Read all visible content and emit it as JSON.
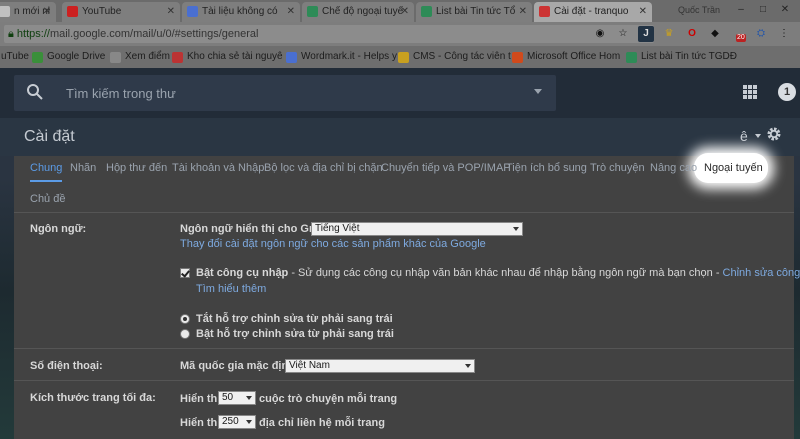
{
  "browser": {
    "tabs": [
      {
        "title": "n mới nh",
        "icon_color": "#c0c0c0"
      },
      {
        "title": "YouTube",
        "icon_color": "#cc2020"
      },
      {
        "title": "Tài liệu không có",
        "icon_color": "#4a6fd0"
      },
      {
        "title": "Chế độ ngoại tuyế",
        "icon_color": "#2e8b57"
      },
      {
        "title": "List bài Tin tức Tổ",
        "icon_color": "#2e8b57"
      },
      {
        "title": "Cài đặt - tranquo",
        "icon_color": "#c33",
        "active": true
      }
    ],
    "profile_name": "Quốc Trần",
    "url_scheme": "https://",
    "url_rest": "mail.google.com/mail/u/0/#settings/general",
    "bookmarks": [
      {
        "label": "uTube",
        "icon_color": "#cc2020"
      },
      {
        "label": "Google Drive",
        "icon_color": "#3a8f3a"
      },
      {
        "label": "Xem điểm",
        "icon_color": "#888"
      },
      {
        "label": "Kho chia sẻ tài nguyê",
        "icon_color": "#b33"
      },
      {
        "label": "Wordmark.it - Helps y",
        "icon_color": "#4a6fd0"
      },
      {
        "label": "CMS - Công tác viên t",
        "icon_color": "#c8a020"
      },
      {
        "label": "Microsoft Office Hom",
        "icon_color": "#d04a1c"
      },
      {
        "label": "List bài Tin tức TGDĐ",
        "icon_color": "#2e8b57"
      }
    ],
    "extension_badge": "20"
  },
  "gmail": {
    "search_placeholder": "Tìm kiếm trong thư",
    "notification_count": "1",
    "settings_title": "Cài đặt",
    "lang_glyph": "ê"
  },
  "settings": {
    "tabs": [
      "Chung",
      "Nhãn",
      "Hộp thư đến",
      "Tài khoản và Nhập",
      "Bộ lọc và địa chỉ bị chặn",
      "Chuyển tiếp và POP/IMAP",
      "Tiện ích bổ sung",
      "Trò chuyện",
      "Nâng cao",
      "Ngoại tuyến"
    ],
    "subtab": "Chủ đề",
    "language": {
      "label": "Ngôn ngữ:",
      "display_label": "Ngôn ngữ hiển thị cho Gmail:",
      "display_value": "Tiếng Việt",
      "change_link": "Thay đổi cài đặt ngôn ngữ cho các sản phẩm khác của Google",
      "ime_bold": "Bật công cụ nhập",
      "ime_desc": " - Sử dụng các công cụ nhập văn bản khác nhau để nhập bằng ngôn ngữ mà bạn chọn - ",
      "ime_edit_link": "Chỉnh sửa công cụ",
      "ime_dash": " -",
      "learn_more": "Tìm hiểu thêm",
      "rtl_off": "Tắt hỗ trợ chỉnh sửa từ phải sang trái",
      "rtl_on": "Bật hỗ trợ chỉnh sửa từ phải sang trái"
    },
    "phone": {
      "label": "Số điện thoại:",
      "country_label": "Mã quốc gia mặc định:",
      "country_value": "Việt Nam"
    },
    "page_size": {
      "label": "Kích thước trang tối đa:",
      "show": "Hiển thị",
      "conv_value": "50",
      "conv_suffix": "cuộc trò chuyện mỗi trang",
      "contacts_value": "250",
      "contacts_suffix": "địa chỉ liên hệ mỗi trang"
    }
  }
}
